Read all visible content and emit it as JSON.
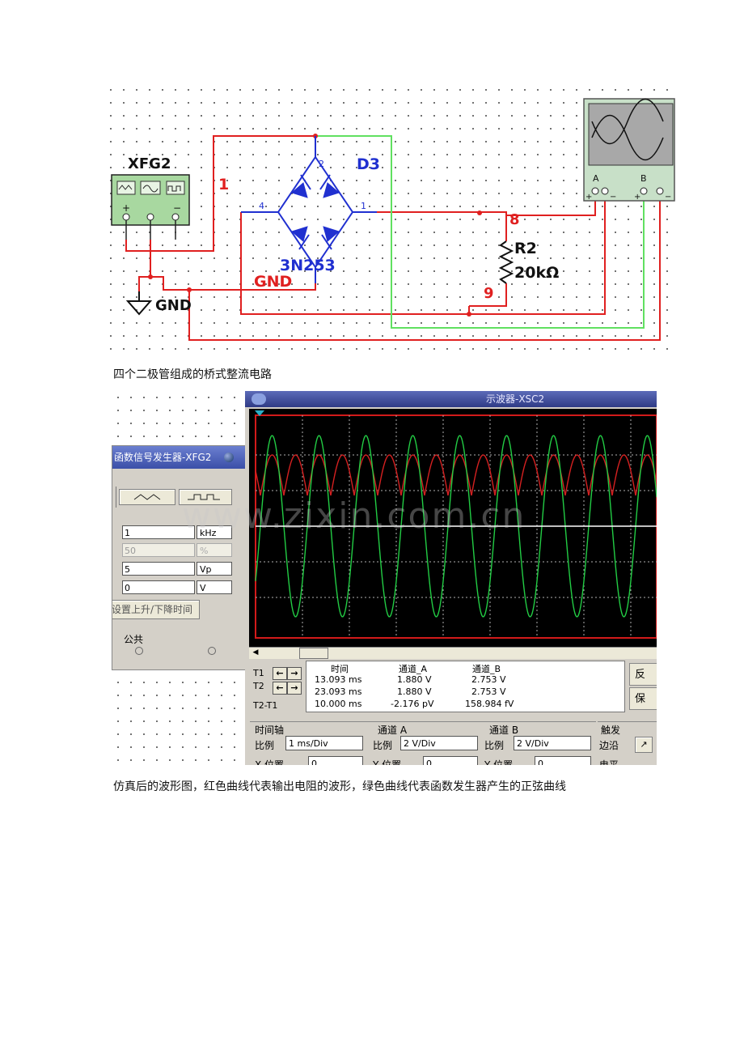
{
  "schematic": {
    "generator_label": "XFG2",
    "net1_label": "1",
    "diode_label": "D3",
    "diode_part": "3N253",
    "resistor_name": "R2",
    "resistor_value": "20kΩ",
    "net8_label": "8",
    "net9_label": "9",
    "gnd_net_label": "GND",
    "gnd_symbol_label": "GND",
    "pin2": "2",
    "pin4": "4",
    "pin1": "1",
    "gen_plus": "+",
    "gen_minus": "−",
    "scope_a": "A",
    "scope_b": "B",
    "scope_plus": "+",
    "scope_minus": "−",
    "scope_plus_b": "+",
    "scope_minus_b": "−"
  },
  "caption1": "四个二极管组成的桥式整流电路",
  "caption2": "仿真后的波形图，红色曲线代表输出电阻的波形，绿色曲线代表函数发生器产生的正弦曲线",
  "watermark": "www.zixin.com.cn",
  "function_generator": {
    "title": "函数信号发生器-XFG2",
    "frequency_value": "1",
    "frequency_unit": "kHz",
    "duty_value": "50",
    "duty_unit": "%",
    "amplitude_value": "5",
    "amplitude_unit": "Vp",
    "offset_value": "0",
    "offset_unit": "V",
    "rise_fall_button": "设置上升/下降时间",
    "common_label": "公共"
  },
  "oscilloscope": {
    "title": "示波器-XSC2",
    "cursor_t1": "T1",
    "cursor_t2": "T2",
    "cursor_diff": "T2-T1",
    "col_time": "时间",
    "col_a": "通道_A",
    "col_b": "通道_B",
    "t1": {
      "time": "13.093 ms",
      "a": "1.880 V",
      "b": "2.753 V"
    },
    "t2": {
      "time": "23.093 ms",
      "a": "1.880 V",
      "b": "2.753 V"
    },
    "diff": {
      "time": "10.000 ms",
      "a": "-2.176 pV",
      "b": "158.984 fV"
    },
    "reverse_button": "反",
    "save_button": "保",
    "timebase": {
      "title": "时间轴",
      "scale_label": "比例",
      "scale_value": "1 ms/Div",
      "pos_label": "X 位置",
      "pos_value": "0"
    },
    "channel_a": {
      "title": "通道 A",
      "scale_label": "比例",
      "scale_value": "2  V/Div",
      "pos_label": "Y 位置",
      "pos_value": "0"
    },
    "channel_b": {
      "title": "通道 B",
      "scale_label": "比例",
      "scale_value": "2  V/Div",
      "pos_label": "Y 位置",
      "pos_value": "0"
    },
    "trigger": {
      "title": "触发",
      "edge_label": "边沿",
      "level_label": "电平"
    },
    "colors": {
      "sine": "#22cc44",
      "rectified": "#d42020",
      "grid": "#b0b0b0"
    }
  }
}
